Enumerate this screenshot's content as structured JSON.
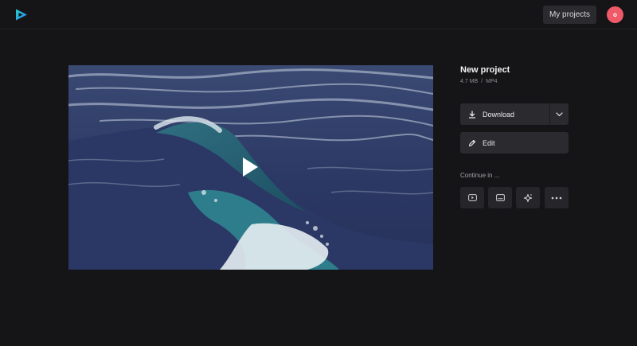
{
  "header": {
    "logo_icon": "play-logo-icon",
    "my_projects_label": "My projects",
    "avatar_initial": "o",
    "avatar_color": "#ee5a67"
  },
  "video": {
    "thumbnail": "ocean-waves",
    "play_icon": "play-icon"
  },
  "project": {
    "name": "New project",
    "size": "4.7 MB",
    "separator": "/",
    "format": "MP4"
  },
  "actions": {
    "download_label": "Download",
    "download_icon": "download-icon",
    "dropdown_icon": "chevron-down-icon",
    "edit_label": "Edit",
    "edit_icon": "pencil-icon"
  },
  "continue_in": {
    "label": "Continue in ...",
    "options": [
      {
        "icon": "youtube-icon"
      },
      {
        "icon": "subtitles-icon"
      },
      {
        "icon": "sparkle-icon"
      },
      {
        "icon": "more-icon"
      }
    ]
  },
  "colors": {
    "background": "#151518",
    "button": "#2a2a2f",
    "accent_logo": "#1fd3c6"
  }
}
